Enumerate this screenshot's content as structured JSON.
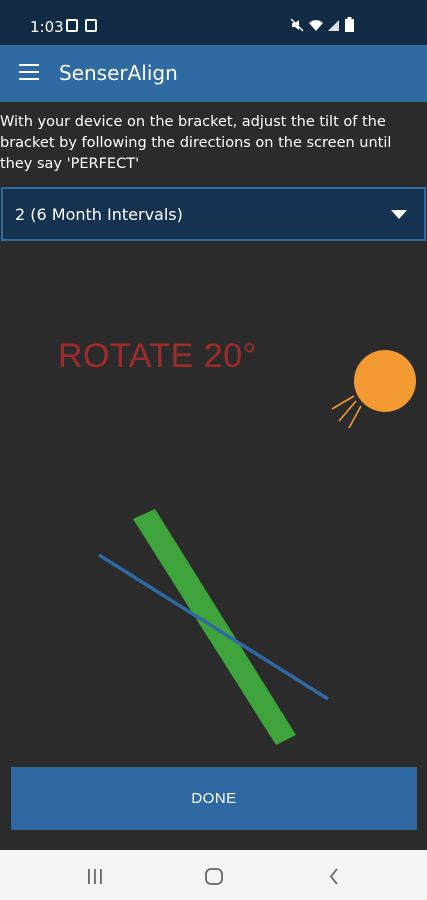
{
  "status_bar": {
    "time": "1:03",
    "left_icons": [
      "image-icon",
      "notification-icon"
    ],
    "right_icons": [
      "mute-icon",
      "wifi-icon",
      "signal-icon",
      "battery-icon"
    ]
  },
  "app_bar": {
    "title": "SenserAlign",
    "menu_icon": "hamburger-menu-icon"
  },
  "instructions": "With your device on the bracket, adjust the tilt of the bracket by following the directions on the screen until they say 'PERFECT'",
  "interval_select": {
    "selected": "2 (6 Month Intervals)"
  },
  "alignment": {
    "instruction": "ROTATE 20°",
    "instruction_color": "#a12a2a",
    "sun_color": "#f49a33",
    "bracket_color": "#3ea43b",
    "target_line_color": "#2f6aa4"
  },
  "done_button": {
    "label": "DONE"
  },
  "nav_bar": {
    "buttons": [
      "recent-apps-icon",
      "home-icon",
      "back-icon"
    ]
  }
}
